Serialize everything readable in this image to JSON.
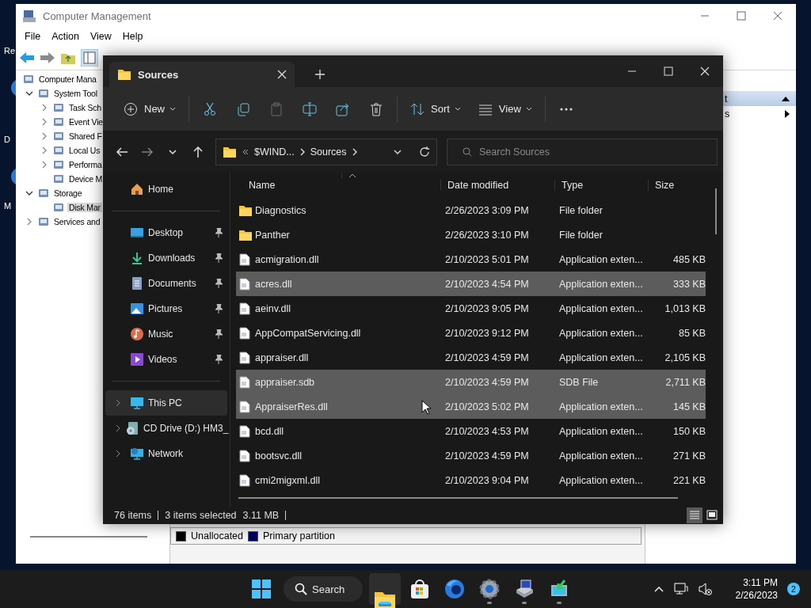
{
  "desktop_icons": [
    {
      "label": "Re"
    },
    {
      "label": "D"
    },
    {
      "label": "M"
    }
  ],
  "computer_management": {
    "title": "Computer Management",
    "menu": [
      "File",
      "Action",
      "View",
      "Help"
    ],
    "tree": [
      {
        "label": "Computer Mana",
        "selected": false,
        "children": [
          {
            "label": "System Tool",
            "expanded": true,
            "selected": false,
            "children": [
              {
                "label": "Task Sch",
                "expanded": false,
                "selected": false
              },
              {
                "label": "Event Vie",
                "expanded": false,
                "selected": false
              },
              {
                "label": "Shared F",
                "expanded": false,
                "selected": false
              },
              {
                "label": "Local Us",
                "expanded": false,
                "selected": false
              },
              {
                "label": "Performa",
                "expanded": false,
                "selected": false
              },
              {
                "label": "Device M",
                "selected": false
              }
            ]
          },
          {
            "label": "Storage",
            "expanded": true,
            "selected": false,
            "children": [
              {
                "label": "Disk Mar",
                "selected": true
              }
            ]
          },
          {
            "label": "Services and",
            "expanded": false,
            "selected": false
          }
        ]
      }
    ],
    "actions": [
      {
        "kind": "header",
        "label": "t"
      },
      {
        "kind": "item",
        "label": "s"
      }
    ],
    "legend": [
      {
        "label": "Unallocated",
        "color": "#000000"
      },
      {
        "label": "Primary partition",
        "color": "#000060"
      }
    ]
  },
  "explorer": {
    "tab": "Sources",
    "toolbar": [
      {
        "items": [
          {
            "kind": "new",
            "label": "New",
            "disabled": false
          }
        ]
      },
      {
        "items": [
          {
            "kind": "cut",
            "disabled": false
          },
          {
            "kind": "copy",
            "disabled": false
          },
          {
            "kind": "paste",
            "disabled": true
          },
          {
            "kind": "rename",
            "disabled": false
          },
          {
            "kind": "share",
            "disabled": false
          },
          {
            "kind": "delete",
            "disabled": false
          }
        ]
      },
      {
        "items": [
          {
            "kind": "sort",
            "label": "Sort",
            "disabled": false
          },
          {
            "kind": "view",
            "label": "View",
            "disabled": false
          }
        ]
      },
      {
        "items": [
          {
            "kind": "more",
            "disabled": false
          }
        ]
      }
    ],
    "nav": [
      {
        "kind": "back",
        "disabled": false
      },
      {
        "kind": "forward",
        "disabled": true
      },
      {
        "kind": "recent",
        "disabled": false
      },
      {
        "kind": "up",
        "disabled": false
      }
    ],
    "path": [
      "$WIND...",
      "Sources"
    ],
    "search": {
      "placeholder": "Search Sources"
    },
    "sidebar": [
      {
        "items": [
          {
            "kind": "home",
            "label": "Home",
            "pinned": false,
            "selected": false
          }
        ]
      },
      {
        "items": [
          {
            "kind": "desktop",
            "label": "Desktop",
            "pinned": true,
            "selected": false
          },
          {
            "kind": "downloads",
            "label": "Downloads",
            "pinned": true,
            "selected": false
          },
          {
            "kind": "documents",
            "label": "Documents",
            "pinned": true,
            "selected": false
          },
          {
            "kind": "pictures",
            "label": "Pictures",
            "pinned": true,
            "selected": false
          },
          {
            "kind": "music",
            "label": "Music",
            "pinned": true,
            "selected": false
          },
          {
            "kind": "videos",
            "label": "Videos",
            "pinned": true,
            "selected": false
          }
        ]
      },
      {
        "items": [
          {
            "kind": "pc",
            "label": "This PC",
            "pinned": false,
            "selected": true,
            "expanded": false
          },
          {
            "kind": "cd",
            "label": "CD Drive (D:) HM3_",
            "pinned": false,
            "selected": false,
            "expanded": false
          },
          {
            "kind": "network",
            "label": "Network",
            "pinned": false,
            "selected": false,
            "expanded": false
          }
        ]
      }
    ],
    "columns": [
      "Name",
      "Date modified",
      "Type",
      "Size"
    ],
    "files": [
      {
        "kind": "folder",
        "name": "Diagnostics",
        "date": "2/26/2023 3:09 PM",
        "type": "File folder",
        "selected": false
      },
      {
        "kind": "folder",
        "name": "Panther",
        "date": "2/26/2023 3:10 PM",
        "type": "File folder",
        "selected": false
      },
      {
        "kind": "file",
        "name": "acmigration.dll",
        "date": "2/10/2023 5:01 PM",
        "type": "Application exten...",
        "size": "485 KB",
        "selected": false
      },
      {
        "kind": "file",
        "name": "acres.dll",
        "date": "2/10/2023 4:54 PM",
        "type": "Application exten...",
        "size": "333 KB",
        "selected": true
      },
      {
        "kind": "file",
        "name": "aeinv.dll",
        "date": "2/10/2023 9:05 PM",
        "type": "Application exten...",
        "size": "1,013 KB",
        "selected": false
      },
      {
        "kind": "file",
        "name": "AppCompatServicing.dll",
        "date": "2/10/2023 9:12 PM",
        "type": "Application exten...",
        "size": "85 KB",
        "selected": false
      },
      {
        "kind": "file",
        "name": "appraiser.dll",
        "date": "2/10/2023 4:59 PM",
        "type": "Application exten...",
        "size": "2,105 KB",
        "selected": false
      },
      {
        "kind": "file",
        "name": "appraiser.sdb",
        "date": "2/10/2023 4:59 PM",
        "type": "SDB File",
        "size": "2,711 KB",
        "selected": true
      },
      {
        "kind": "file",
        "name": "AppraiserRes.dll",
        "date": "2/10/2023 5:02 PM",
        "type": "Application exten...",
        "size": "145 KB",
        "selected": true
      },
      {
        "kind": "file",
        "name": "bcd.dll",
        "date": "2/10/2023 4:53 PM",
        "type": "Application exten...",
        "size": "150 KB",
        "selected": false
      },
      {
        "kind": "file",
        "name": "bootsvc.dll",
        "date": "2/10/2023 4:59 PM",
        "type": "Application exten...",
        "size": "271 KB",
        "selected": false
      },
      {
        "kind": "file",
        "name": "cmi2migxml.dll",
        "date": "2/10/2023 9:04 PM",
        "type": "Application exten...",
        "size": "221 KB",
        "selected": false
      }
    ],
    "status": {
      "count": "76 items",
      "selection": "3 items selected",
      "size": "3.11 MB"
    },
    "views": [
      {
        "kind": "details",
        "selected": true
      },
      {
        "kind": "tiles",
        "selected": false
      }
    ]
  },
  "taskbar": {
    "search": "Search",
    "apps": [
      {
        "kind": "explorer",
        "active": true,
        "running": true
      },
      {
        "kind": "store",
        "active": false,
        "running": false
      },
      {
        "kind": "browser",
        "active": false,
        "running": false
      },
      {
        "kind": "settings",
        "active": false,
        "running": true
      },
      {
        "kind": "computer",
        "active": false,
        "running": true
      },
      {
        "kind": "monitor",
        "active": false,
        "running": true
      }
    ],
    "time": "3:11 PM",
    "date": "2/26/2023",
    "notifications": "2"
  }
}
